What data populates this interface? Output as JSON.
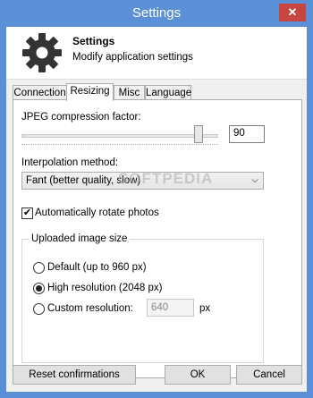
{
  "window": {
    "title": "Settings",
    "close_glyph": "✕"
  },
  "header": {
    "title": "Settings",
    "subtitle": "Modify application settings",
    "icon": "gear-icon"
  },
  "tabs": [
    {
      "label": "Connection",
      "active": false
    },
    {
      "label": "Resizing",
      "active": true
    },
    {
      "label": "Misc",
      "active": false
    },
    {
      "label": "Language",
      "active": false
    }
  ],
  "resizing": {
    "jpeg_label": "JPEG compression factor:",
    "jpeg_value": "90",
    "slider_fraction": 0.9,
    "interpolation_label": "Interpolation method:",
    "interpolation_selected": "Fant (better quality, slow)",
    "watermark": "SOFTPEDIA",
    "auto_rotate_label": "Automatically rotate photos",
    "auto_rotate_checked": true,
    "upload_group_title": "Uploaded image size",
    "radio_default": "Default (up to 960 px)",
    "radio_high": "High resolution (2048 px)",
    "radio_custom": "Custom resolution:",
    "custom_value": "640",
    "custom_unit": "px",
    "selected_option": "high"
  },
  "footer": {
    "reset_label": "Reset confirmations",
    "ok_label": "OK",
    "cancel_label": "Cancel"
  },
  "colors": {
    "titlebar": "#5b8fd6",
    "close": "#c7463f"
  }
}
